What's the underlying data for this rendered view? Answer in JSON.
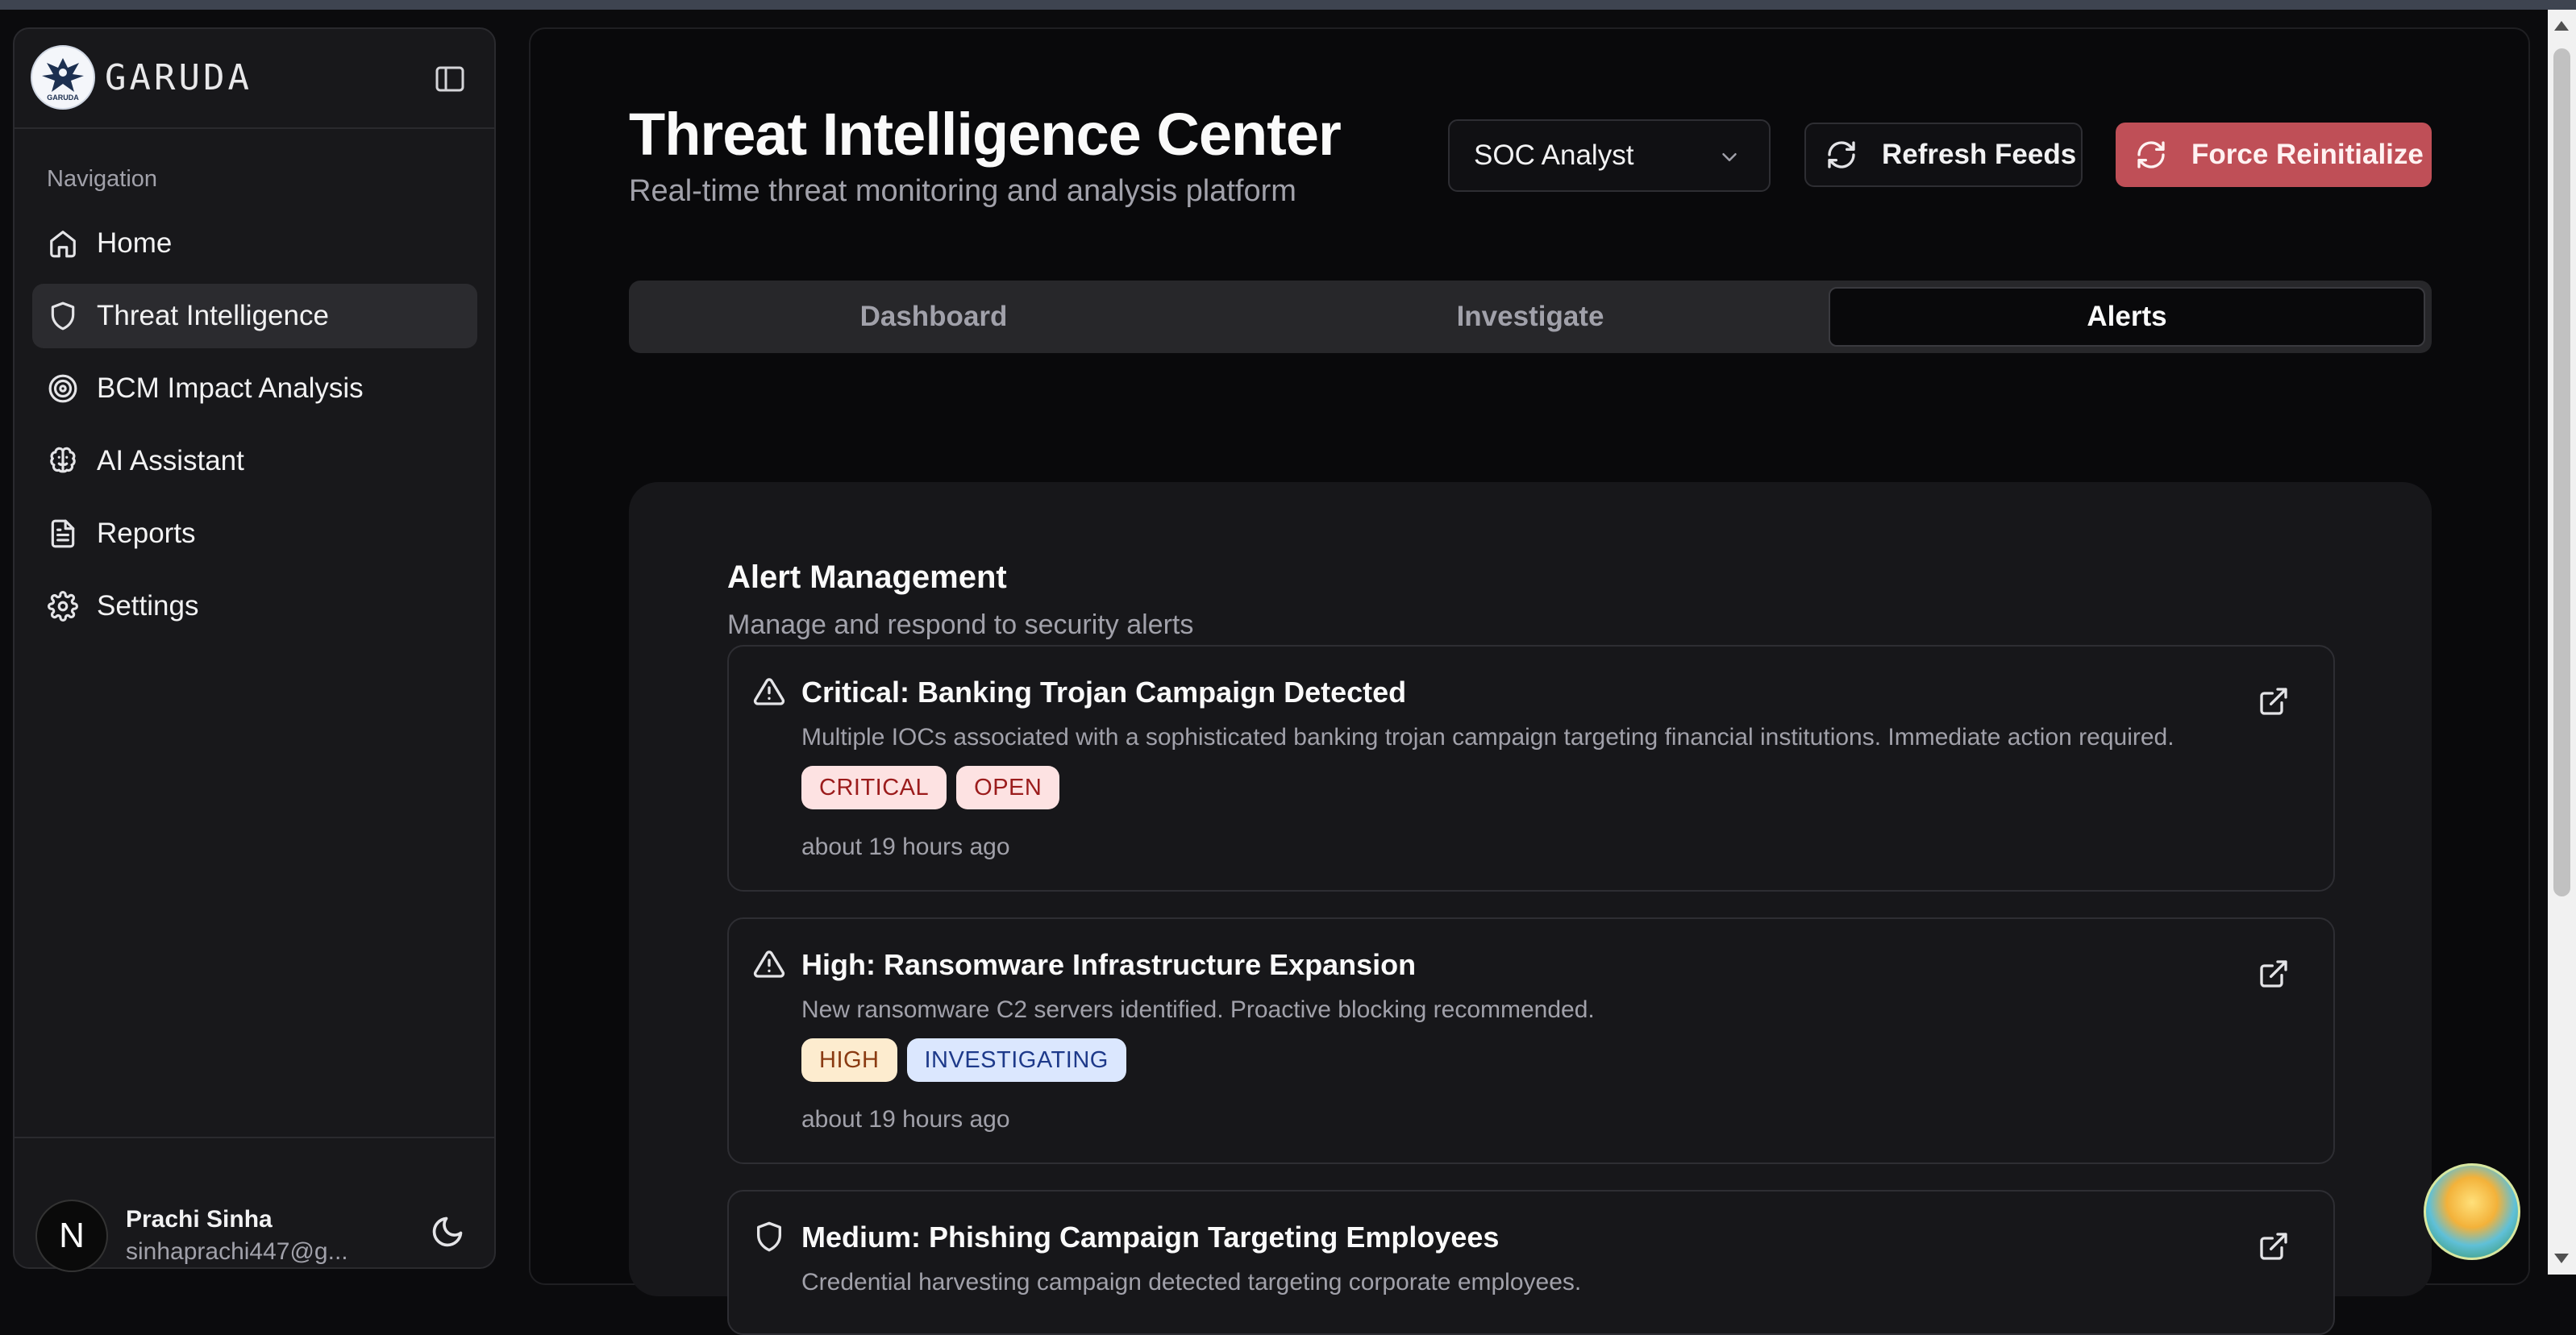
{
  "brand": {
    "name": "GARUDA",
    "logo_text": "GARUDA"
  },
  "sidebar": {
    "nav_title": "Navigation",
    "items": [
      {
        "label": "Home",
        "icon": "home-icon",
        "active": false
      },
      {
        "label": "Threat Intelligence",
        "icon": "shield-icon",
        "active": true
      },
      {
        "label": "BCM Impact Analysis",
        "icon": "target-icon",
        "active": false
      },
      {
        "label": "AI Assistant",
        "icon": "brain-icon",
        "active": false
      },
      {
        "label": "Reports",
        "icon": "file-text-icon",
        "active": false
      },
      {
        "label": "Settings",
        "icon": "gear-icon",
        "active": false
      }
    ],
    "user": {
      "initial": "N",
      "name": "Prachi Sinha",
      "email": "sinhaprachi447@g..."
    }
  },
  "header": {
    "title": "Threat Intelligence Center",
    "subtitle": "Real-time threat monitoring and analysis platform",
    "role_select": {
      "value": "SOC Analyst"
    },
    "refresh_label": "Refresh Feeds",
    "force_label": "Force Reinitialize"
  },
  "tabs": [
    {
      "label": "Dashboard",
      "active": false
    },
    {
      "label": "Investigate",
      "active": false
    },
    {
      "label": "Alerts",
      "active": true
    }
  ],
  "alerts_panel": {
    "title": "Alert Management",
    "description": "Manage and respond to security alerts",
    "alerts": [
      {
        "icon": "warning-triangle-icon",
        "title": "Critical: Banking Trojan Campaign Detected",
        "description": "Multiple IOCs associated with a sophisticated banking trojan campaign targeting financial institutions. Immediate action required.",
        "tags": [
          {
            "label": "CRITICAL",
            "bg": "#fde2e2",
            "fg": "#9b1c1c"
          },
          {
            "label": "OPEN",
            "bg": "#fde2e2",
            "fg": "#9b1c1c"
          }
        ],
        "time": "about 19 hours ago"
      },
      {
        "icon": "warning-triangle-icon",
        "title": "High: Ransomware Infrastructure Expansion",
        "description": "New ransomware C2 servers identified. Proactive blocking recommended.",
        "tags": [
          {
            "label": "HIGH",
            "bg": "#fdeccf",
            "fg": "#8a3b12"
          },
          {
            "label": "INVESTIGATING",
            "bg": "#dbe7fe",
            "fg": "#1e3a8a"
          }
        ],
        "time": "about 19 hours ago"
      },
      {
        "icon": "shield-icon",
        "title": "Medium: Phishing Campaign Targeting Employees",
        "description": "Credential harvesting campaign detected targeting corporate employees.",
        "tags": [],
        "time": ""
      }
    ]
  },
  "colors": {
    "accent_force": "#bf4f57",
    "background": "#09090b",
    "sidebar_bg": "#18181b"
  }
}
